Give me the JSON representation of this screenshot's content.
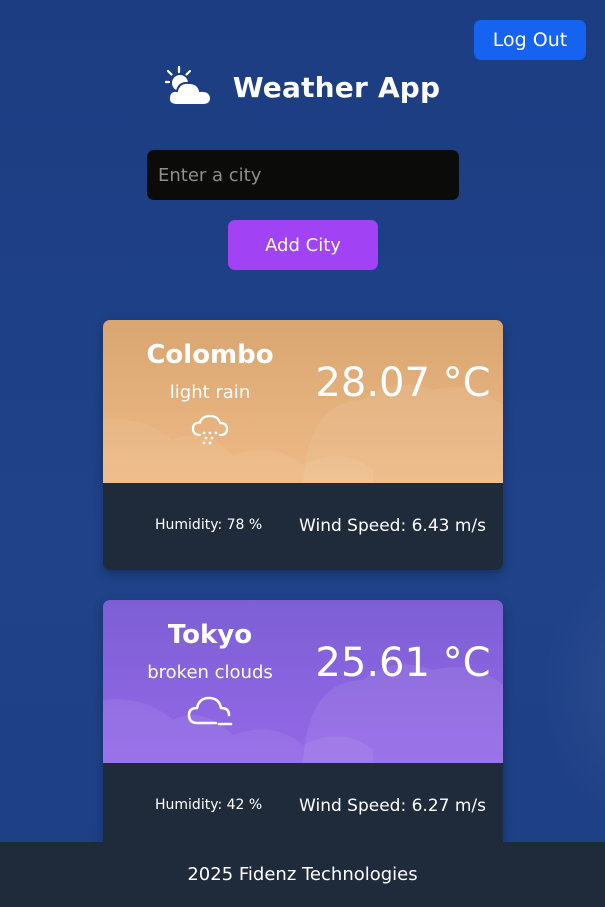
{
  "header": {
    "logout_label": "Log Out",
    "app_icon": "sun-cloud-icon",
    "title": "Weather App"
  },
  "search": {
    "placeholder": "Enter a city",
    "value": "",
    "add_label": "Add City"
  },
  "cards": [
    {
      "city": "Colombo",
      "description": "light rain",
      "icon": "cloud-rain-icon",
      "temperature": "28.07 °C",
      "humidity": "Humidity: 78 %",
      "wind": "Wind Speed: 6.43 m/s",
      "color_top": "#d9a672",
      "color_bottom": "#eeb984"
    },
    {
      "city": "Tokyo",
      "description": "broken clouds",
      "icon": "cloud-icon",
      "temperature": "25.61 °C",
      "humidity": "Humidity: 42 %",
      "wind": "Wind Speed: 6.27 m/s",
      "color_top": "#7d5fd4",
      "color_bottom": "#9468e8"
    }
  ],
  "footer": {
    "text": "2025 Fidenz Technologies"
  },
  "colors": {
    "background": "#1e3f85",
    "logout_button": "#1563f0",
    "add_button": "#a142f4",
    "card_bottom": "#1f2a3a"
  }
}
